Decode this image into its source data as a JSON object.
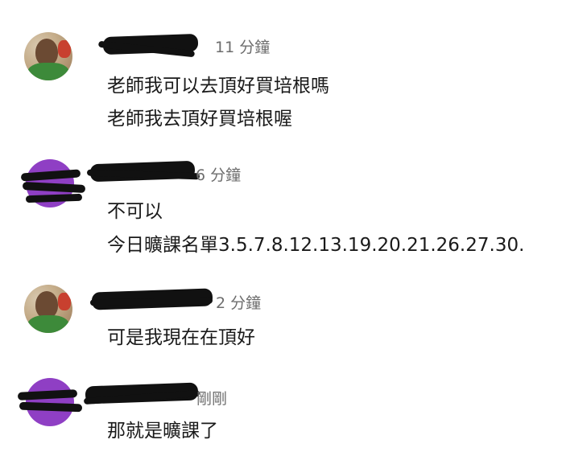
{
  "comments": [
    {
      "author_redacted": true,
      "avatar": "student-photo",
      "time": "11 分鐘",
      "lines": [
        "老師我可以去頂好買培根嗎",
        "老師我去頂好買培根喔"
      ]
    },
    {
      "author_redacted": true,
      "avatar": "purple-redacted",
      "time": "6 分鐘",
      "lines": [
        "不可以",
        "今日曠課名單3.5.7.8.12.13.19.20.21.26.27.30."
      ]
    },
    {
      "author_redacted": true,
      "avatar": "student-photo",
      "time": "2 分鐘",
      "lines": [
        "可是我現在在頂好"
      ]
    },
    {
      "author_redacted": true,
      "avatar": "purple-redacted",
      "time": "剛剛",
      "lines": [
        "那就是曠課了"
      ]
    }
  ],
  "colors": {
    "purple_avatar": "#8f3fc4",
    "time_text": "#6d6d6d",
    "body_text": "#1a1a1a"
  }
}
